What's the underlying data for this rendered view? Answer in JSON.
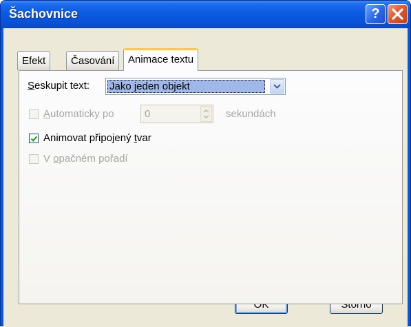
{
  "window": {
    "title": "Šachovnice",
    "help_icon": "question-mark-icon",
    "close_icon": "close-x-icon"
  },
  "tabs": [
    {
      "label": "Efekt",
      "active": false
    },
    {
      "label": "Časování",
      "active": false
    },
    {
      "label": "Animace textu",
      "active": true
    }
  ],
  "form": {
    "group_text": {
      "label_underlined": "S",
      "label_rest": "eskupit text:",
      "value": "Jako jeden objekt"
    },
    "auto_after": {
      "label_underlined": "A",
      "label_rest": "utomaticky po",
      "value": "0",
      "unit": "sekundách",
      "checked": false,
      "enabled": false
    },
    "animate_shape": {
      "label_before": "Animovat připojený ",
      "label_underlined": "t",
      "label_after": "var",
      "checked": true,
      "enabled": true
    },
    "reverse_order": {
      "label_before": "V ",
      "label_underlined": "o",
      "label_after": "pačném pořadí",
      "checked": false,
      "enabled": false
    }
  },
  "buttons": {
    "ok": "OK",
    "cancel": "Storno"
  },
  "colors": {
    "titlebar": "#0b57d8",
    "dialog_bg": "#ece9d8",
    "close_button": "#e05a31",
    "active_tab_accent": "#ffc83c",
    "selection": "#9fb8e9"
  }
}
